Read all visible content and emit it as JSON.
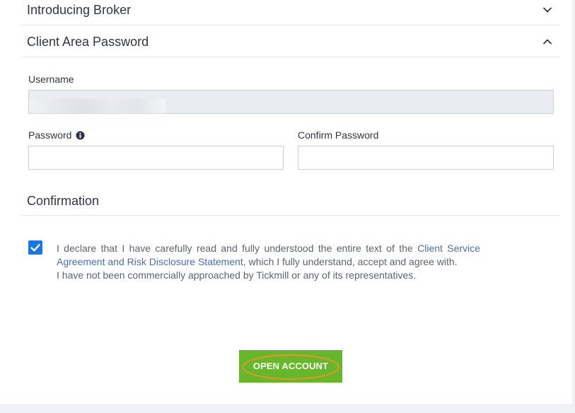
{
  "sections": {
    "introducing_broker": {
      "title": "Introducing Broker",
      "expanded": false
    },
    "client_area_password": {
      "title": "Client Area Password",
      "expanded": true
    },
    "confirmation": {
      "title": "Confirmation"
    }
  },
  "form": {
    "username_label": "Username",
    "username_value": "",
    "password_label": "Password",
    "confirm_password_label": "Confirm Password",
    "password_value": "",
    "confirm_password_value": ""
  },
  "declaration": {
    "checked": true,
    "text_before": "I declare that I have carefully read and fully understood the entire text of the ",
    "link_text": "Client Service Agreement and Risk Disclosure Statement",
    "text_after": ", which I fully understand, accept and agree with.",
    "line2": "I have not been commercially approached by Tickmill or any of its representatives."
  },
  "buttons": {
    "open_account": "OPEN ACCOUNT"
  },
  "icons": {
    "expand": "chevron-down-icon",
    "collapse": "chevron-up-icon",
    "info": "info-icon",
    "check": "check-icon"
  },
  "colors": {
    "accent_green": "#66b82a",
    "highlight_orange": "#f0912c",
    "checkbox_blue": "#1976e6",
    "link_blue": "#4a6fb5"
  }
}
